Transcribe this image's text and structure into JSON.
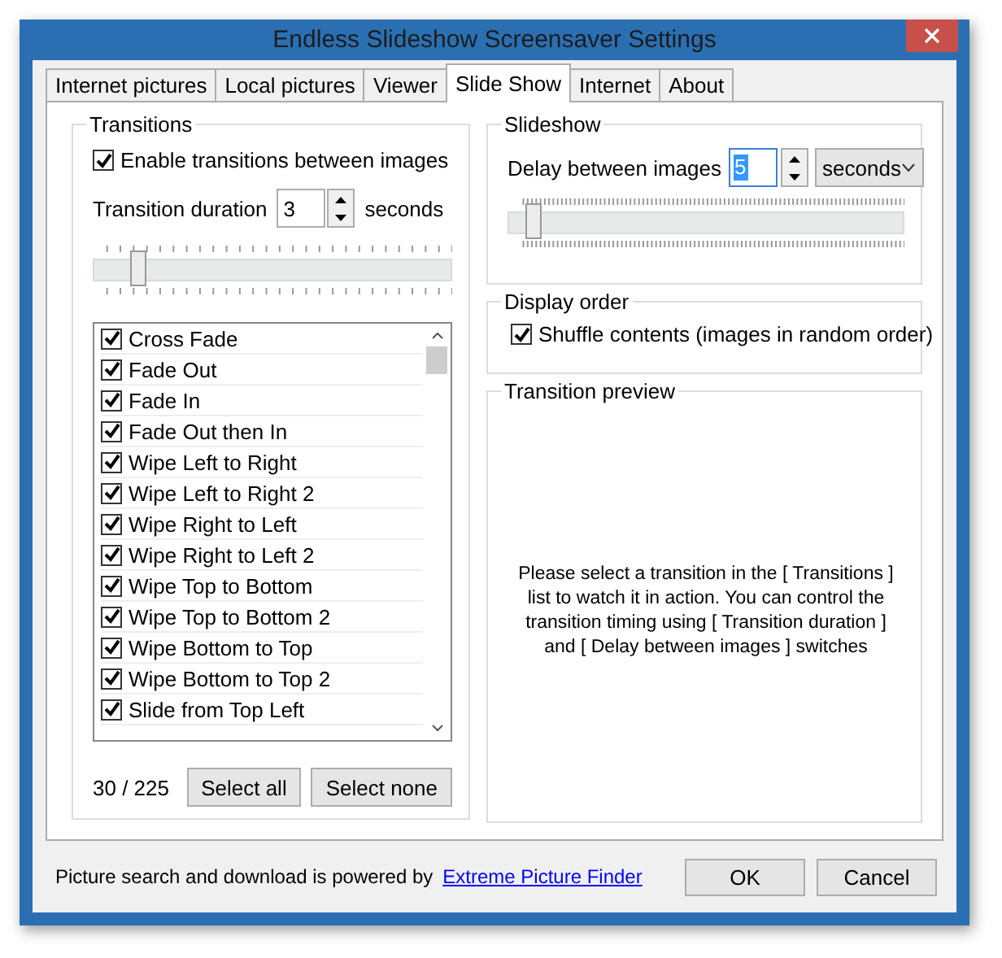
{
  "window": {
    "title": "Endless Slideshow Screensaver Settings"
  },
  "tabs": [
    {
      "label": "Internet pictures",
      "selected": false
    },
    {
      "label": "Local pictures",
      "selected": false
    },
    {
      "label": "Viewer",
      "selected": false
    },
    {
      "label": "Slide Show",
      "selected": true
    },
    {
      "label": "Internet",
      "selected": false
    },
    {
      "label": "About",
      "selected": false
    }
  ],
  "transitions": {
    "title": "Transitions",
    "enable": {
      "label": "Enable transitions between images",
      "checked": true
    },
    "duration": {
      "label": "Transition duration",
      "value": "3",
      "unit": "seconds",
      "level": 0.11
    },
    "items": [
      {
        "label": "Cross Fade",
        "checked": true
      },
      {
        "label": "Fade Out",
        "checked": true
      },
      {
        "label": "Fade In",
        "checked": true
      },
      {
        "label": "Fade Out then In",
        "checked": true
      },
      {
        "label": "Wipe Left to Right",
        "checked": true
      },
      {
        "label": "Wipe Left to Right 2",
        "checked": true
      },
      {
        "label": "Wipe Right to Left",
        "checked": true
      },
      {
        "label": "Wipe Right to Left 2",
        "checked": true
      },
      {
        "label": "Wipe Top to Bottom",
        "checked": true
      },
      {
        "label": "Wipe Top to Bottom 2",
        "checked": true
      },
      {
        "label": "Wipe Bottom to Top",
        "checked": true
      },
      {
        "label": "Wipe Bottom to Top 2",
        "checked": true
      },
      {
        "label": "Slide from Top Left",
        "checked": true
      }
    ],
    "count": "30 / 225",
    "buttons": [
      "Select all",
      "Select none"
    ]
  },
  "slideshow": {
    "title": "Slideshow",
    "label": "Delay between images",
    "value": "5",
    "unit": "seconds",
    "level": 0.05
  },
  "display_order": {
    "title": "Display order",
    "shuffle": {
      "label": "Shuffle contents (images in random order)",
      "checked": true
    }
  },
  "preview": {
    "title": "Transition preview",
    "text": "Please select a transition in the [ Transitions ] list to watch it in action. You can control the transition timing using [ Transition duration ] and [ Delay between images ] switches"
  },
  "footer": {
    "text": "Picture search and download is powered by",
    "link": "Extreme Picture Finder",
    "buttons": [
      "OK",
      "Cancel"
    ]
  }
}
